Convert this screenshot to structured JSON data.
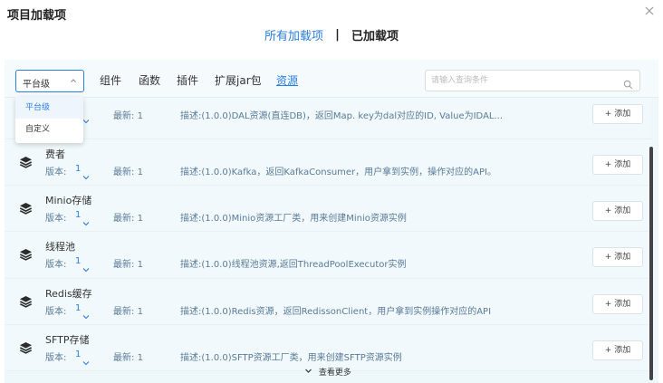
{
  "dialog": {
    "title": "项目加载项",
    "close_icon": "close-icon"
  },
  "tabs": {
    "all": "所有加载项",
    "separator": "|",
    "loaded": "已加载项"
  },
  "toolbar": {
    "select_value": "平台级",
    "categories": [
      "组件",
      "函数",
      "插件",
      "扩展jar包",
      "资源"
    ],
    "active_category": "资源",
    "search_placeholder": "请输入查询条件"
  },
  "dropdown": {
    "options": [
      "平台级",
      "自定义"
    ],
    "selected": "平台级"
  },
  "labels": {
    "version": "版本:",
    "latest": "最新:",
    "add": "+ 添加",
    "desc_prefix": "描述:"
  },
  "items": [
    {
      "name": "",
      "version": "1",
      "latest": "1",
      "desc": "(1.0.0)DAL资源(直连DB)，返回Map. key为dal对应的ID, Value为IDAL..."
    },
    {
      "name": "费者",
      "version": "1",
      "latest": "1",
      "desc": "(1.0.0)Kafka，返回KafkaConsumer，用户拿到实例，操作对应的API。"
    },
    {
      "name": "Minio存储",
      "version": "1",
      "latest": "1",
      "desc": "(1.0.0)Minio资源工厂类，用来创建Minio资源实例"
    },
    {
      "name": "线程池",
      "version": "1",
      "latest": "1",
      "desc": "(1.0.0)线程池资源,返回ThreadPoolExecutor实例"
    },
    {
      "name": "Redis缓存",
      "version": "1",
      "latest": "1",
      "desc": "(1.0.0)Redis资源，返回RedissonClient，用户拿到实例操作对应的API"
    },
    {
      "name": "SFTP存储",
      "version": "1",
      "latest": "1",
      "desc": "(1.0.0)SFTP资源工厂类，用来创建SFTP资源实例"
    }
  ],
  "more": {
    "label": "查看更多"
  },
  "colors": {
    "accent": "#2a7ee0",
    "row_bg": "#f1f9fc",
    "desc_text": "#5a7a99"
  }
}
